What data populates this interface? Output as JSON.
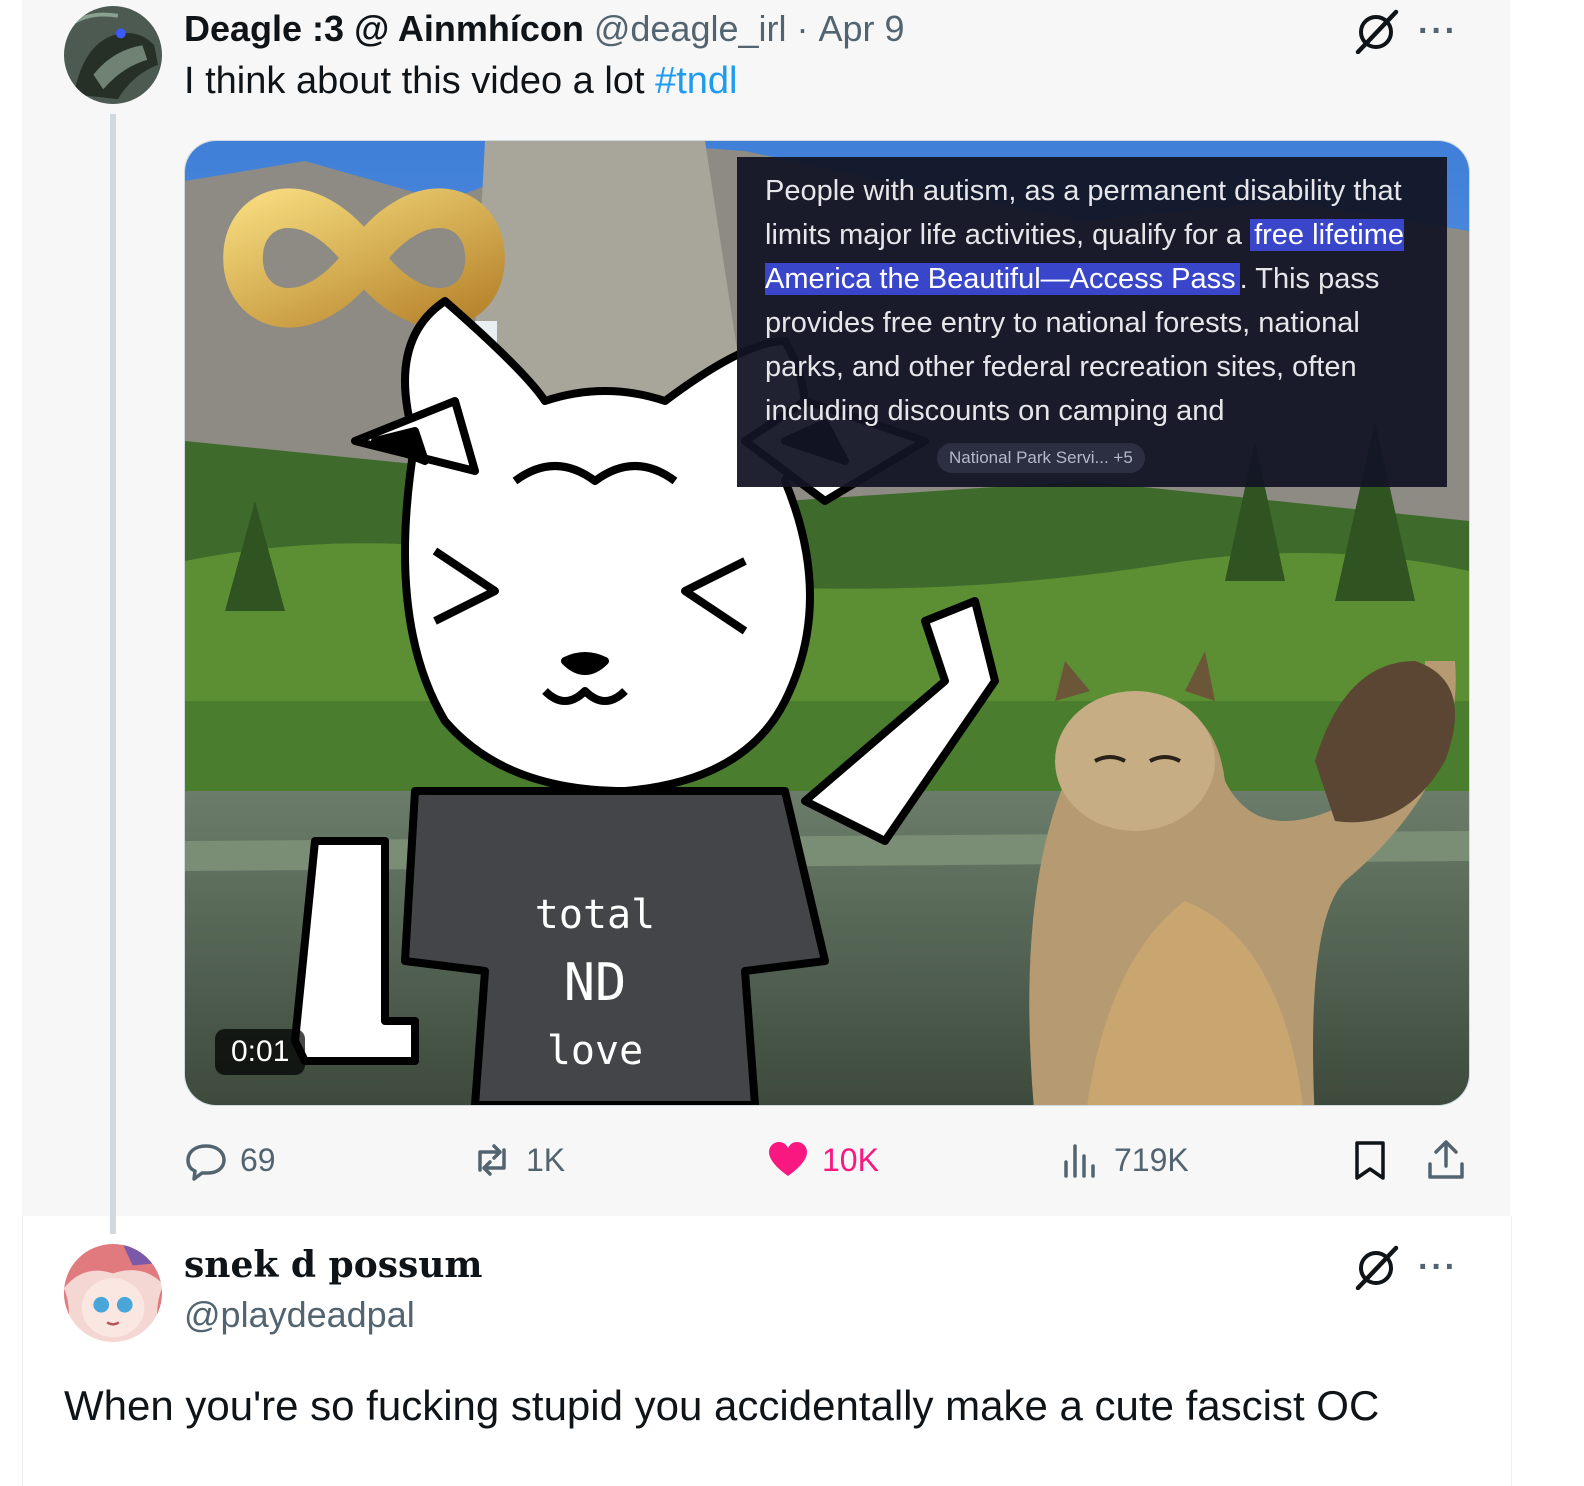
{
  "quoted_post": {
    "display_name": "Deagle :3 @ Ainmhícon",
    "handle": "@deagle_irl",
    "separator": "·",
    "date": "Apr 9",
    "text": "I think about this video a lot ",
    "hashtag": "#tndl",
    "media": {
      "overlay_text_before": "People with autism, as a permanent disability that limits major life activities, qualify for a ",
      "overlay_highlight": "free lifetime America the Beautiful—Access Pass",
      "overlay_text_after": ". This pass provides free entry to national forests, national parks, and other federal recreation sites, often including discounts on camping and",
      "overlay_source": "National Park Servi... +5",
      "shirt_text_1": "total",
      "shirt_text_2": "ND",
      "shirt_text_3": "love",
      "timestamp": "0:01"
    },
    "actions": {
      "replies": "69",
      "reposts": "1K",
      "likes": "10K",
      "views": "719K"
    },
    "more_label": "···"
  },
  "reply_post": {
    "display_name": "snek d possum",
    "handle": "@playdeadpal",
    "text": "When you're so fucking stupid you accidentally make a cute fascist OC",
    "more_label": "···"
  },
  "colors": {
    "link": "#1d9bf0",
    "like": "#f91880",
    "secondary_text": "#536471",
    "highlight": "#3a46c9"
  },
  "icons": [
    "grok-icon",
    "more-icon",
    "reply-icon",
    "repost-icon",
    "heart-icon",
    "views-icon",
    "bookmark-icon",
    "share-icon"
  ]
}
